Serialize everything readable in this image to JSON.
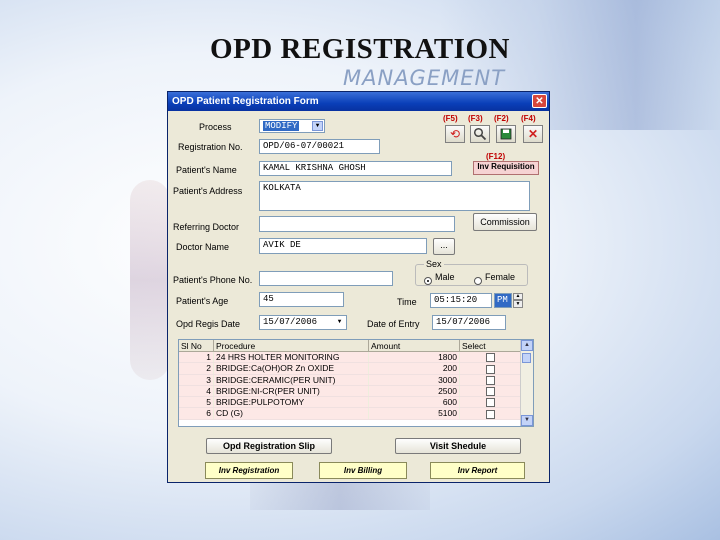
{
  "slide": {
    "title": "OPD REGISTRATION",
    "subtitle": "MANAGEMENT"
  },
  "window": {
    "title": "OPD Patient Registration Form",
    "close": "✕"
  },
  "form": {
    "process_label": "Process",
    "process_value": "MODIFY",
    "reg_no_label": "Registration No.",
    "reg_no_value": "OPD/06-07/00021",
    "patient_name_label": "Patient's Name",
    "patient_name_value": "KAMAL KRISHNA GHOSH",
    "address_label": "Patient's Address",
    "address_value": "KOLKATA",
    "referring_doctor_label": "Referring Doctor",
    "referring_doctor_value": "",
    "doctor_name_label": "Doctor Name",
    "doctor_name_value": "AVIK DE",
    "phone_label": "Patient's Phone No.",
    "phone_value": "",
    "age_label": "Patient's Age",
    "age_value": "45",
    "reg_date_label": "Opd Regis Date",
    "reg_date_value": "15/07/2006",
    "time_label": "Time",
    "time_value": "05:15:20",
    "ampm_value": "PM",
    "entry_date_label": "Date of Entry",
    "entry_date_value": "15/07/2006",
    "sex_label": "Sex",
    "male_label": "Male",
    "female_label": "Female",
    "commission_label": "Commission",
    "ellipsis": "...",
    "inv_requisition_short": "Inv Requisition"
  },
  "toolbar": {
    "fkeys": [
      "(F5)",
      "(F3)",
      "(F2)",
      "(F4)"
    ],
    "f12": "(F12)",
    "icons": [
      "refresh-icon",
      "search-icon",
      "save-icon",
      "delete-icon"
    ]
  },
  "grid": {
    "headers": [
      "Sl No",
      "Procedure",
      "Amount",
      "Select"
    ],
    "rows": [
      {
        "sl": "1",
        "procedure": "24 HRS HOLTER MONITORING",
        "amount": "1800"
      },
      {
        "sl": "2",
        "procedure": "BRIDGE:Ca(OH)OR Zn OXIDE",
        "amount": "200"
      },
      {
        "sl": "3",
        "procedure": "BRIDGE:CERAMIC(PER UNIT)",
        "amount": "3000"
      },
      {
        "sl": "4",
        "procedure": "BRIDGE:NI-CR(PER UNIT)",
        "amount": "2500"
      },
      {
        "sl": "5",
        "procedure": "BRIDGE:PULPOTOMY",
        "amount": "600"
      },
      {
        "sl": "6",
        "procedure": "CD (G)",
        "amount": "5100"
      }
    ]
  },
  "buttons": {
    "opd_slip": "Opd Registration Slip",
    "visit_schedule": "Visit Shedule",
    "inv_registration": "Inv Registration",
    "inv_billing": "Inv Billing",
    "inv_report": "Inv Report"
  }
}
